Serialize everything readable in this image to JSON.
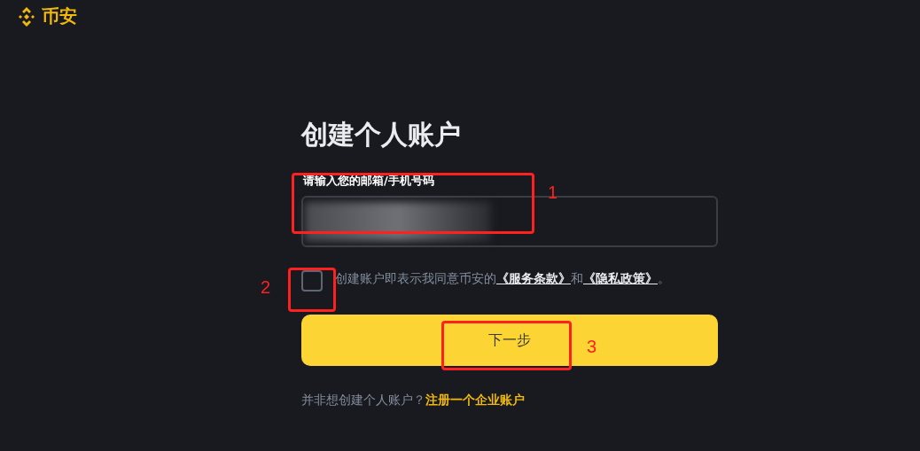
{
  "logo": {
    "text": "币安"
  },
  "title": "创建个人账户",
  "email_field": {
    "label": "请输入您的邮箱/手机号码",
    "value_redacted": true
  },
  "terms": {
    "checked": false,
    "parts": [
      {
        "kind": "text",
        "text": "创建账户即表示我同意币安的"
      },
      {
        "kind": "link",
        "text": "《服务条款》"
      },
      {
        "kind": "text",
        "text": "和"
      },
      {
        "kind": "link",
        "text": "《隐私政策》"
      },
      {
        "kind": "text",
        "text": "。"
      }
    ]
  },
  "next_button": "下一步",
  "footer": {
    "text": "并非想创建个人账户？",
    "link": "注册一个企业账户"
  },
  "annotations": [
    {
      "label": "1"
    },
    {
      "label": "2"
    },
    {
      "label": "3"
    }
  ]
}
